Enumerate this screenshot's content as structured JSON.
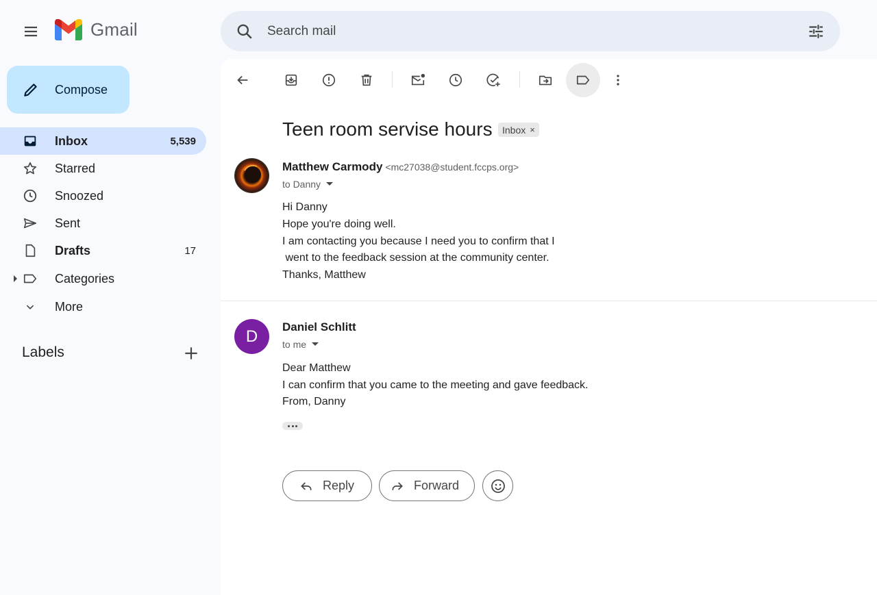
{
  "app": {
    "name": "Gmail"
  },
  "search": {
    "placeholder": "Search mail"
  },
  "compose": {
    "label": "Compose"
  },
  "sidebar": {
    "items": [
      {
        "label": "Inbox",
        "count": "5,539",
        "icon": "inbox-icon"
      },
      {
        "label": "Starred",
        "count": "",
        "icon": "star-icon"
      },
      {
        "label": "Snoozed",
        "count": "",
        "icon": "clock-icon"
      },
      {
        "label": "Sent",
        "count": "",
        "icon": "send-icon"
      },
      {
        "label": "Drafts",
        "count": "17",
        "icon": "draft-icon"
      },
      {
        "label": "Categories",
        "count": "",
        "icon": "label-icon"
      },
      {
        "label": "More",
        "count": "",
        "icon": "chevron-down-icon"
      }
    ],
    "labels_heading": "Labels"
  },
  "toolbar": {
    "icons": [
      "back-icon",
      "archive-icon",
      "report-spam-icon",
      "delete-icon",
      "mark-unread-icon",
      "snooze-icon",
      "add-task-icon",
      "move-to-icon",
      "label-icon",
      "more-vert-icon"
    ]
  },
  "thread": {
    "subject": "Teen room servise hours",
    "tag": "Inbox",
    "tag_close": "×",
    "messages": [
      {
        "sender": "Matthew Carmody",
        "email": "<mc27038@student.fccps.org>",
        "to": "to Danny",
        "lines": [
          "Hi Danny",
          "Hope you're doing well.",
          "I am contacting you because I need you to confirm that I",
          " went to the feedback session at the community center.",
          "Thanks, Matthew"
        ]
      },
      {
        "sender": "Daniel Schlitt",
        "avatar_letter": "D",
        "to": "to me",
        "lines": [
          "Dear Matthew",
          "I can confirm that you came to the meeting and gave feedback.",
          "From, Danny"
        ]
      }
    ]
  },
  "actions": {
    "reply": "Reply",
    "forward": "Forward"
  },
  "colors": {
    "background": "#f8fafd",
    "compose_bg": "#c2e7ff",
    "active_nav": "#d3e3fd",
    "search_bg": "#e9eef6",
    "avatar_d": "#7b1fa2"
  }
}
